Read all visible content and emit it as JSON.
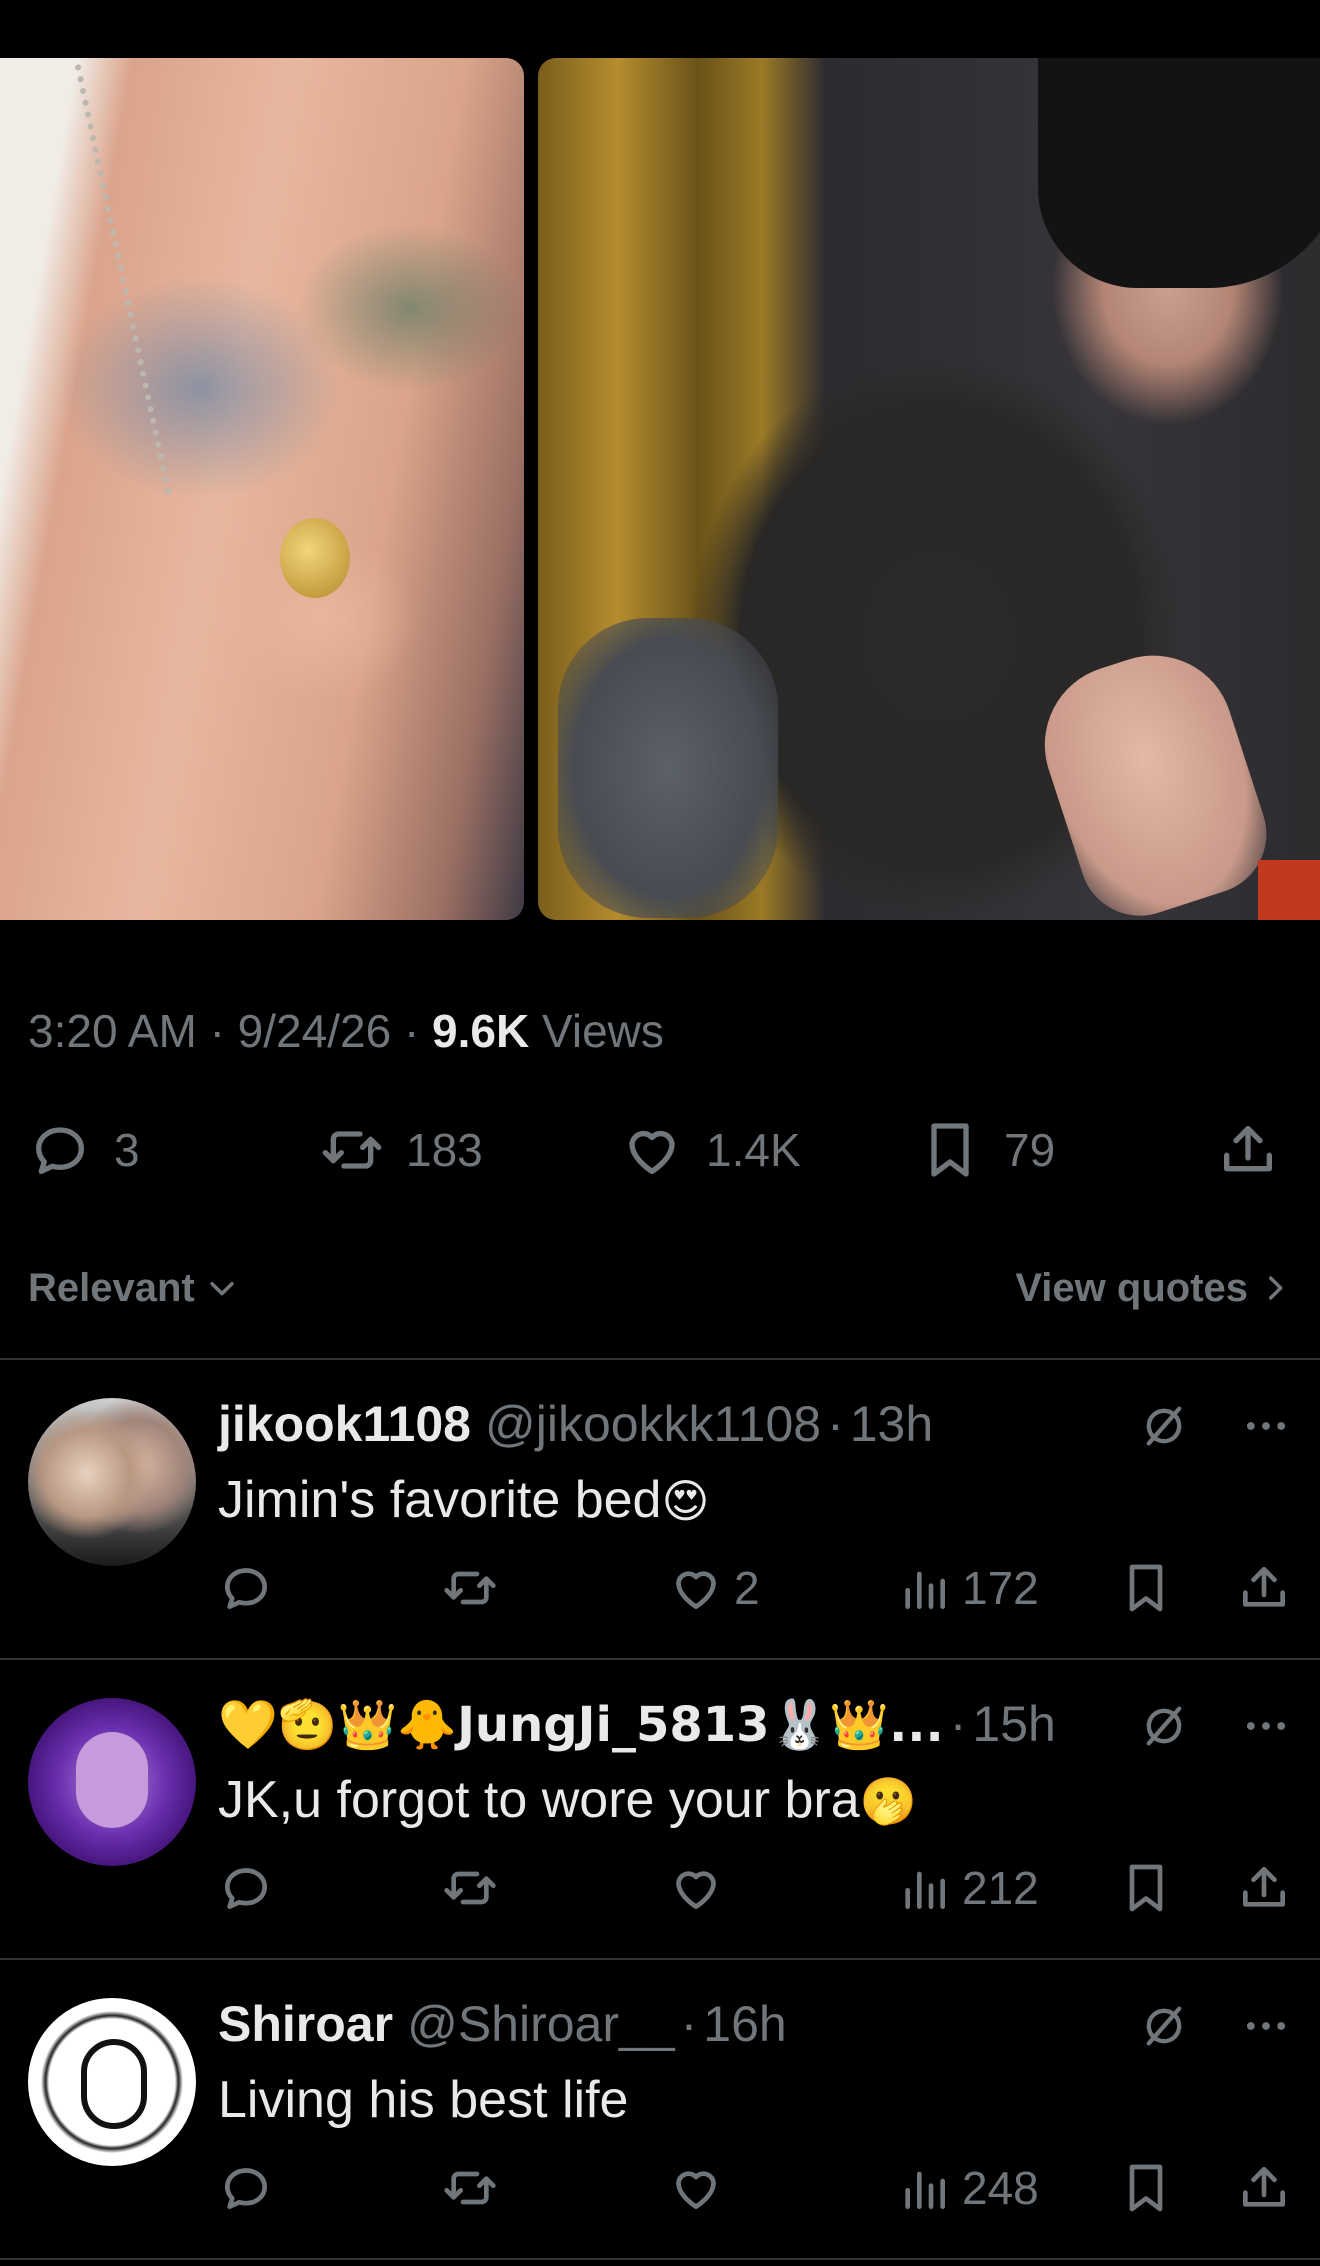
{
  "post": {
    "time": "3:20 AM",
    "sep": "·",
    "date": "9/24/26",
    "views_count": "9.6K",
    "views_label": "Views"
  },
  "actions": {
    "replies": "3",
    "reposts": "183",
    "likes": "1.4K",
    "bookmarks": "79"
  },
  "sort": {
    "label": "Relevant",
    "view_quotes": "View quotes"
  },
  "replies": [
    {
      "name": "jikook1108",
      "handle": "@jikookkk1108",
      "time": "13h",
      "text": "Jimin's favorite bed",
      "emoji": "😍",
      "likes": "2",
      "views": "172"
    },
    {
      "name": "💛🫡👑🐥JungJi_5813🐰👑...",
      "handle": "",
      "time": "15h",
      "text": "JK,u forgot to wore your bra",
      "emoji": "🫢",
      "likes": "",
      "views": "212"
    },
    {
      "name": "Shiroar",
      "handle": "@Shiroar__",
      "time": "16h",
      "text": "Living his best life",
      "emoji": "",
      "likes": "",
      "views": "248"
    }
  ],
  "icons": {
    "reply": "reply-icon",
    "repost": "repost-icon",
    "like": "heart-icon",
    "bookmark": "bookmark-icon",
    "share": "share-icon",
    "views": "analytics-icon",
    "grok": "grok-icon",
    "more": "more-icon"
  },
  "colors": {
    "background": "#000000",
    "text": "#e7e9ea",
    "muted": "#71767b",
    "divider": "#2f3336"
  }
}
